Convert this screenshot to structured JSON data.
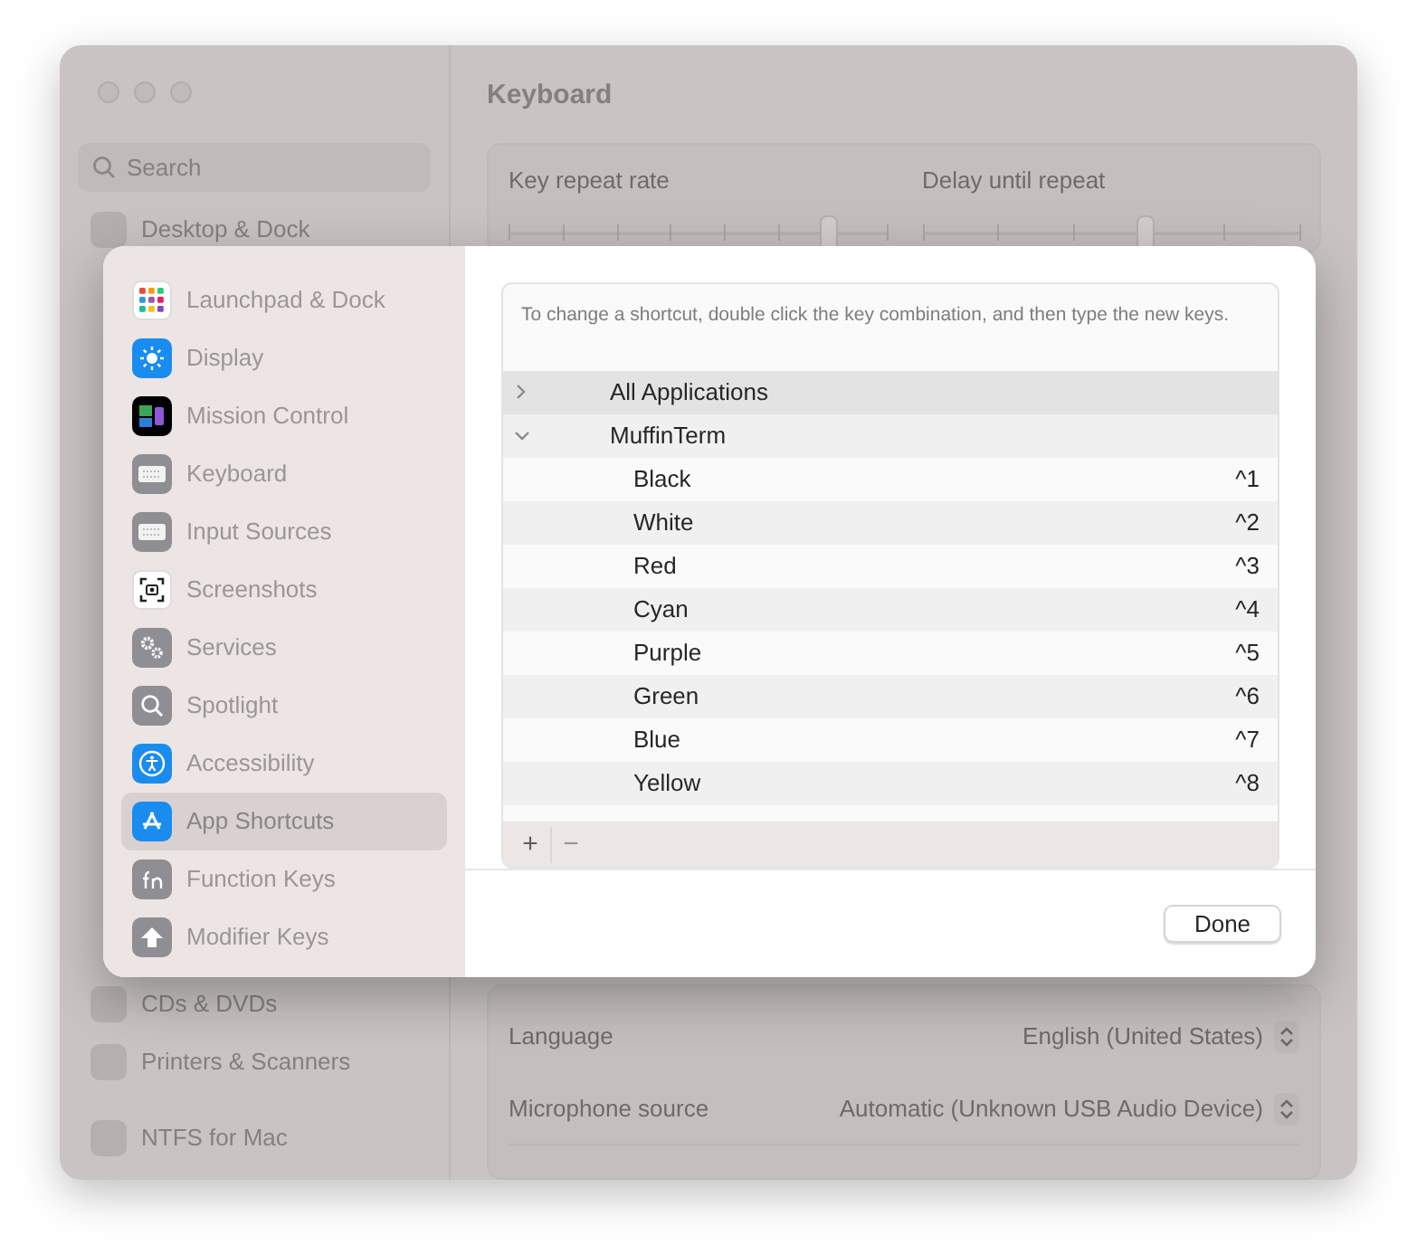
{
  "background": {
    "title": "Keyboard",
    "search": {
      "placeholder": "Search"
    },
    "sidebar": [
      {
        "label": "Desktop & Dock"
      },
      {
        "label": "CDs & DVDs"
      },
      {
        "label": "Printers & Scanners"
      },
      {
        "label": "NTFS for Mac"
      }
    ],
    "sliders": [
      {
        "label": "Key repeat rate",
        "level": 0.85
      },
      {
        "label": "Delay until repeat",
        "level": 0.59
      }
    ],
    "settings": [
      {
        "label": "Language",
        "value": "English (United States)"
      },
      {
        "label": "Microphone source",
        "value": "Automatic (Unknown USB Audio Device)"
      }
    ]
  },
  "dialog": {
    "sidebar": [
      {
        "label": "Launchpad & Dock",
        "selected": false
      },
      {
        "label": "Display",
        "selected": false
      },
      {
        "label": "Mission Control",
        "selected": false
      },
      {
        "label": "Keyboard",
        "selected": false
      },
      {
        "label": "Input Sources",
        "selected": false
      },
      {
        "label": "Screenshots",
        "selected": false
      },
      {
        "label": "Services",
        "selected": false
      },
      {
        "label": "Spotlight",
        "selected": false
      },
      {
        "label": "Accessibility",
        "selected": false
      },
      {
        "label": "App Shortcuts",
        "selected": true
      },
      {
        "label": "Function Keys",
        "selected": false
      },
      {
        "label": "Modifier Keys",
        "selected": false
      }
    ],
    "hint": "To change a shortcut, double click the key combination, and then type the new keys.",
    "tree": [
      {
        "label": "All Applications",
        "expanded": false,
        "selected": true
      },
      {
        "label": "MuffinTerm",
        "expanded": true,
        "selected": false,
        "children": [
          {
            "label": "Black",
            "shortcut": "^1"
          },
          {
            "label": "White",
            "shortcut": "^2"
          },
          {
            "label": "Red",
            "shortcut": "^3"
          },
          {
            "label": "Cyan",
            "shortcut": "^4"
          },
          {
            "label": "Purple",
            "shortcut": "^5"
          },
          {
            "label": "Green",
            "shortcut": "^6"
          },
          {
            "label": "Blue",
            "shortcut": "^7"
          },
          {
            "label": "Yellow",
            "shortcut": "^8"
          }
        ]
      }
    ],
    "list_buttons": [
      {
        "label": "+",
        "disabled": false
      },
      {
        "label": "−",
        "disabled": true
      }
    ],
    "done_button": "Done"
  }
}
